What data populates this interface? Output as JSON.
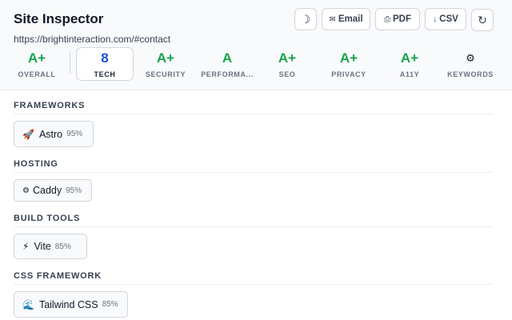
{
  "header": {
    "title": "Site Inspector",
    "url": "https://brightinteraction.com/#contact",
    "buttons": {
      "theme_icon": "☽",
      "email_icon": "✉",
      "email_label": "Email",
      "pdf_icon": "⎙",
      "pdf_label": "PDF",
      "csv_icon": "↓",
      "csv_label": "CSV",
      "refresh_icon": "↻"
    }
  },
  "scores": [
    {
      "grade": "A+",
      "label": "OVERALL"
    },
    {
      "grade": "8",
      "label": "TECH",
      "active": true
    },
    {
      "grade": "A+",
      "label": "SECURITY"
    },
    {
      "grade": "A",
      "label": "PERFORMA..."
    },
    {
      "grade": "A+",
      "label": "SEO"
    },
    {
      "grade": "A+",
      "label": "PRIVACY"
    },
    {
      "grade": "A+",
      "label": "A11Y"
    },
    {
      "grade": "⚙",
      "label": "KEYWORDS"
    }
  ],
  "sections": [
    {
      "title": "FRAMEWORKS",
      "items": [
        {
          "icon": "🚀",
          "name": "Astro",
          "confidence": "95%"
        }
      ]
    },
    {
      "title": "HOSTING",
      "items": [
        {
          "icon": "⚙",
          "name": "Caddy",
          "confidence": "95%"
        }
      ]
    },
    {
      "title": "BUILD TOOLS",
      "items": [
        {
          "icon": "⚡",
          "name": "Vite",
          "confidence": "85%"
        }
      ]
    },
    {
      "title": "CSS FRAMEWORK",
      "items": [
        {
          "icon": "🌊",
          "name": "Tailwind CSS",
          "confidence": "85%"
        }
      ]
    }
  ],
  "colors": {
    "grade_green": "#16a34a",
    "tech_blue": "#1d4ed8",
    "header_bg": "#f8fafc"
  }
}
